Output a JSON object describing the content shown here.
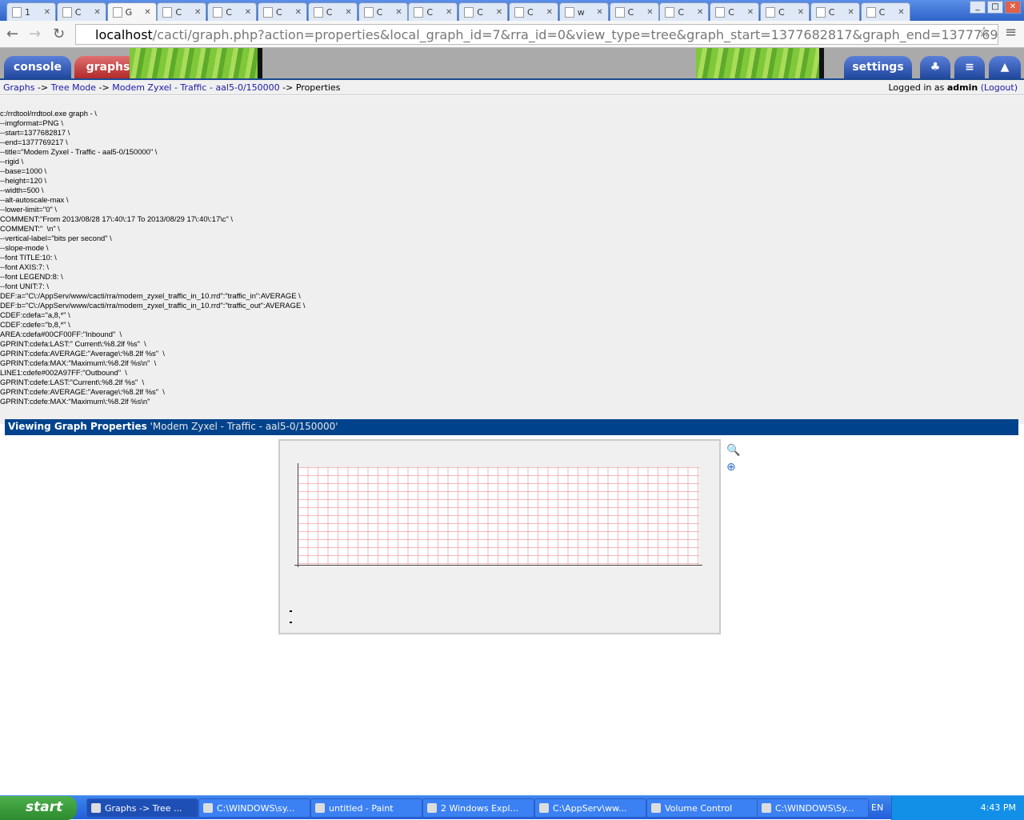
{
  "browser": {
    "tabs": [
      {
        "label": "1",
        "icon": "pma"
      },
      {
        "label": "C",
        "icon": "cacti"
      },
      {
        "label": "G",
        "icon": "cacti",
        "active": true
      },
      {
        "label": "C",
        "icon": "page"
      },
      {
        "label": "C",
        "icon": "page"
      },
      {
        "label": "C",
        "icon": "page"
      },
      {
        "label": "C",
        "icon": "page"
      },
      {
        "label": "C",
        "icon": "page"
      },
      {
        "label": "C",
        "icon": "page"
      },
      {
        "label": "C",
        "icon": "page"
      },
      {
        "label": "C",
        "icon": "page"
      },
      {
        "label": "w",
        "icon": "google"
      },
      {
        "label": "C",
        "icon": "page"
      },
      {
        "label": "C",
        "icon": "page"
      },
      {
        "label": "C",
        "icon": "page"
      },
      {
        "label": "C",
        "icon": "page"
      },
      {
        "label": "C",
        "icon": "page"
      },
      {
        "label": "C",
        "icon": "page"
      }
    ],
    "url_host": "localhost",
    "url_rest": "/cacti/graph.php?action=properties&local_graph_id=7&rra_id=0&view_type=tree&graph_start=1377682817&graph_end=1377769217"
  },
  "header": {
    "console": "console",
    "graphs": "graphs",
    "settings": "settings"
  },
  "breadcrumb": {
    "items": [
      "Graphs",
      "Tree Mode",
      "Modem Zyxel - Traffic - aal5-0/150000"
    ],
    "sep": " -> ",
    "current": "Properties",
    "login_prefix": "Logged in as ",
    "user": "admin",
    "logout": "(Logout)"
  },
  "command": [
    "c:/rrdtool/rrdtool.exe graph - \\",
    "--imgformat=PNG \\",
    "--start=1377682817 \\",
    "--end=1377769217 \\",
    "--title=\"Modem Zyxel - Traffic - aal5-0/150000\" \\",
    "--rigid \\",
    "--base=1000 \\",
    "--height=120 \\",
    "--width=500 \\",
    "--alt-autoscale-max \\",
    "--lower-limit=\"0\" \\",
    "COMMENT:\"From 2013/08/28 17\\:40\\:17 To 2013/08/29 17\\:40\\:17\\c\" \\",
    "COMMENT:\"  \\n\" \\",
    "--vertical-label=\"bits per second\" \\",
    "--slope-mode \\",
    "--font TITLE:10: \\",
    "--font AXIS:7: \\",
    "--font LEGEND:8: \\",
    "--font UNIT:7: \\",
    "DEF:a=\"C\\:/AppServ/www/cacti/rra/modem_zyxel_traffic_in_10.rrd\":\"traffic_in\":AVERAGE \\",
    "DEF:b=\"C\\:/AppServ/www/cacti/rra/modem_zyxel_traffic_in_10.rrd\":\"traffic_out\":AVERAGE \\",
    "CDEF:cdefa=\"a,8,*\" \\",
    "CDEF:cdefe=\"b,8,*\" \\",
    "AREA:cdefa#00CF00FF:\"Inbound\"  \\",
    "GPRINT:cdefa:LAST:\" Current\\:%8.2lf %s\"  \\",
    "GPRINT:cdefa:AVERAGE:\"Average\\:%8.2lf %s\"  \\",
    "GPRINT:cdefa:MAX:\"Maximum\\:%8.2lf %s\\n\"  \\",
    "LINE1:cdefe#002A97FF:\"Outbound\"  \\",
    "GPRINT:cdefe:LAST:\"Current\\:%8.2lf %s\"  \\",
    "GPRINT:cdefe:AVERAGE:\"Average\\:%8.2lf %s\"  \\",
    "GPRINT:cdefe:MAX:\"Maximum\\:%8.2lf %s\\n\""
  ],
  "properties": {
    "label": "Viewing Graph Properties",
    "title": "'Modem Zyxel - Traffic - aal5-0/150000'"
  },
  "taskbar": {
    "start": "start",
    "tasks": [
      "Graphs -> Tree ...",
      "C:\\WINDOWS\\sy...",
      "untitled - Paint",
      "2 Windows Expl...",
      "C:\\AppServ\\ww...",
      "Volume Control",
      "C:\\WINDOWS\\Sy..."
    ],
    "lang": "EN",
    "clock": "4:43 PM"
  },
  "colors": {
    "header_blue": "#00438c",
    "link": "#1a1aa6"
  }
}
